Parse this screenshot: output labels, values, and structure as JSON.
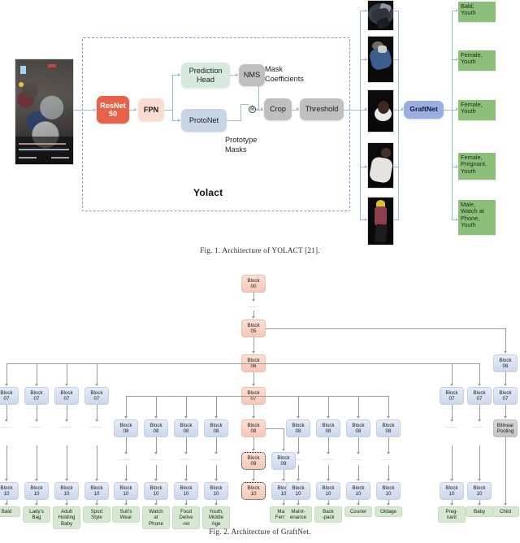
{
  "figure1": {
    "caption": "Fig. 1. Architecture of YOLACT [21].",
    "container_label": "Yolact",
    "input_image_alt": "surveillance-frame",
    "nodes": {
      "resnet": "ResNet\n50",
      "fpn": "FPN",
      "prediction_head": "Prediction\nHead",
      "nms": "NMS",
      "protonet": "ProtoNet",
      "crop": "Crop",
      "threshold": "Threshold",
      "graftnet": "GraftNet"
    },
    "annotations": {
      "mask_coefficients": "Mask\nCoefficients",
      "prototype_masks": "Prototype\nMasks",
      "multiply_symbol": "⊗"
    },
    "crops": [
      {
        "alt": "person-crop-1"
      },
      {
        "alt": "person-crop-2"
      },
      {
        "alt": "person-crop-3"
      },
      {
        "alt": "person-crop-4"
      },
      {
        "alt": "person-crop-5"
      }
    ],
    "predictions": [
      "Bald,\nYouth",
      "Female,\nYouth",
      "Female,\nYouth",
      "Female,\nPregnant,\nYouth",
      "Male,\nWatch at\nPhone,\nYouth"
    ]
  },
  "figure2": {
    "caption": "Fig. 2. Architecture of GraftNet.",
    "dots": "......",
    "trunk": [
      {
        "label": "Block\n00",
        "color": "salmon"
      },
      {
        "label": "Block\n05",
        "color": "salmon"
      },
      {
        "label": "Block\n06",
        "color": "salmon"
      },
      {
        "label": "Block\n07",
        "color": "salmon"
      },
      {
        "label": "Block\n08",
        "color": "salmon"
      },
      {
        "label": "Block\n09",
        "color": "salmon"
      },
      {
        "label": "Block\n10",
        "color": "salmon"
      }
    ],
    "bilinear_pooling": "Bilinear\nPooling",
    "block_labels": {
      "b06": "Block\n06",
      "b07": "Block\n07",
      "b08": "Block\n08",
      "b09": "Block\n09",
      "b10": "Block\n10"
    },
    "leaves": [
      "Bald",
      "Lady's\nBag",
      "Adult\nHolding\nBaby",
      "Sport\nStyle",
      "Suit's\nWear",
      "Watch\nat\nPhone",
      "Food\nDelive\n-rer",
      "Youth,\nMiddle\nAge",
      "Male,\nFemale",
      "Maint-\nenance",
      "Back\n-pack",
      "Courier",
      "Oldage",
      "Preg-\nnant",
      "Baby",
      "Child"
    ]
  },
  "colors": {
    "salmon": "#f6c8b6",
    "blue": "#ccd8ec",
    "green_leaf": "#d6e8d2",
    "green_label": "#8cc07a",
    "resnet_red": "#e8624a",
    "graftnet_blue": "#9aaee0",
    "grey": "#bfbfbf",
    "connector_blue": "#9dbbe0",
    "connector_grey": "#9a9a9a"
  }
}
